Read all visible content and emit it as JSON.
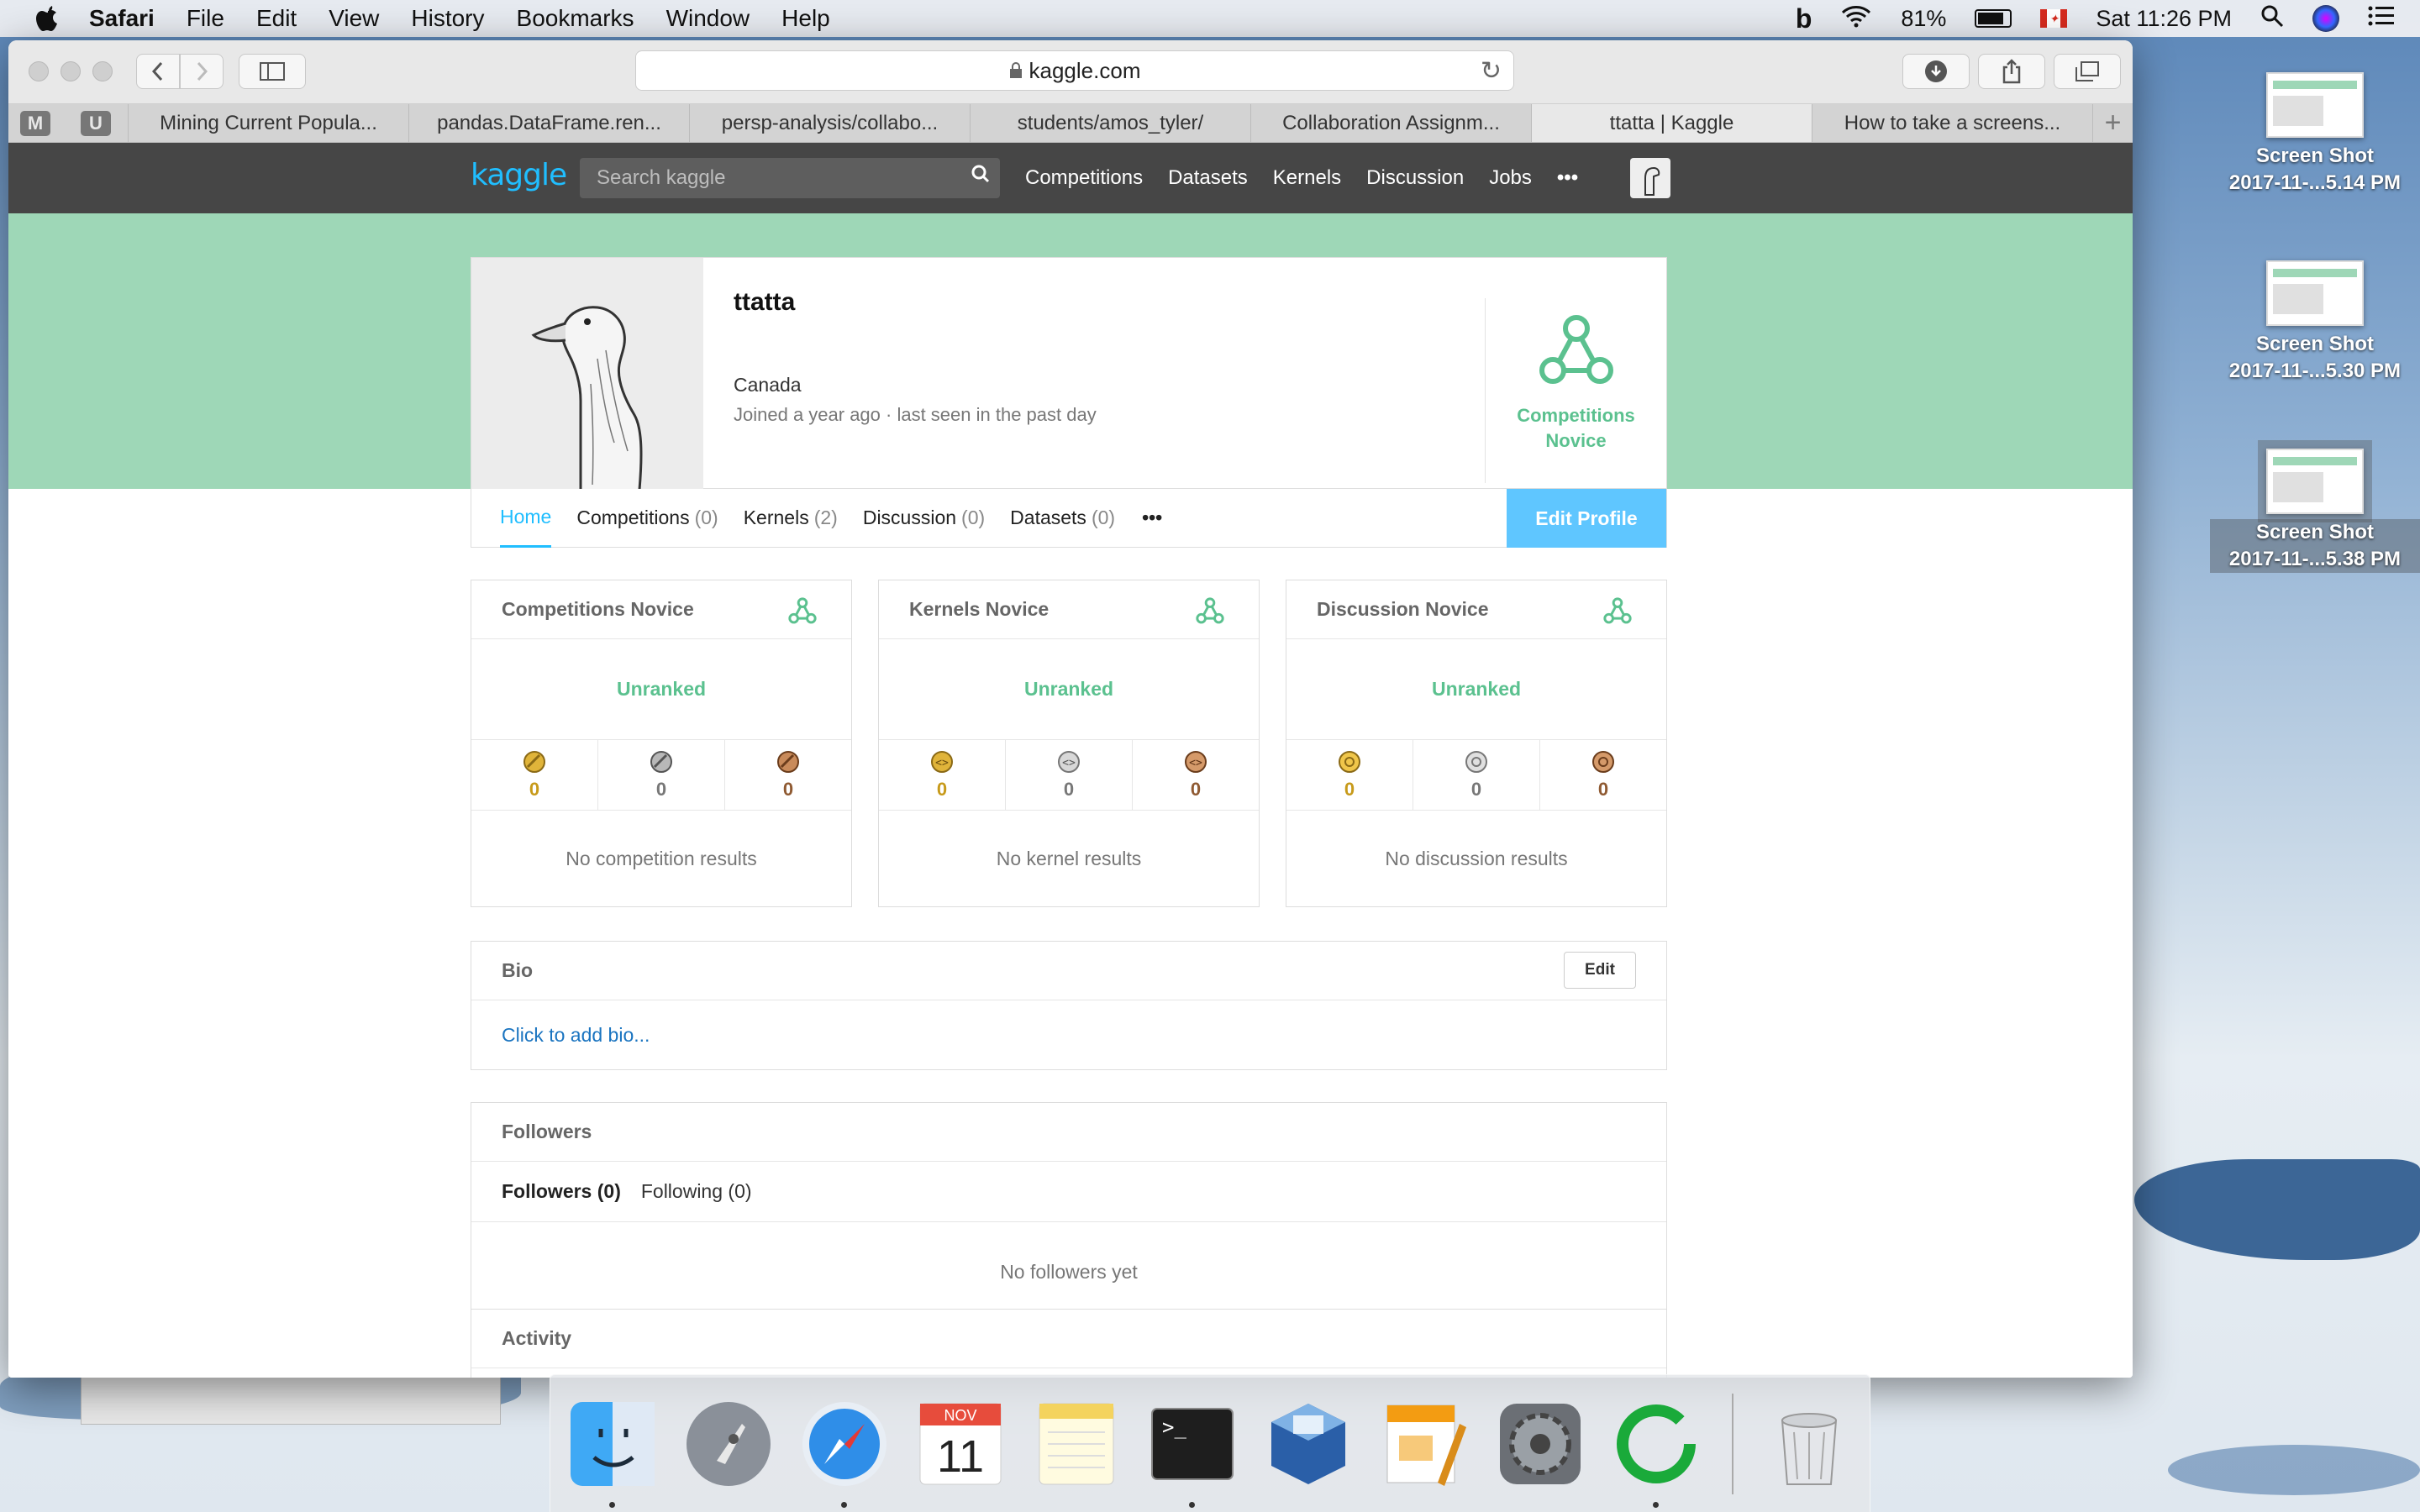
{
  "menubar": {
    "app": "Safari",
    "items": [
      "File",
      "Edit",
      "View",
      "History",
      "Bookmarks",
      "Window",
      "Help"
    ],
    "battery": "81%",
    "clock": "Sat 11:26 PM"
  },
  "browser": {
    "url": "kaggle.com",
    "pinned": [
      "M",
      "U"
    ],
    "tabs": [
      "Mining Current Popula...",
      "pandas.DataFrame.ren...",
      "persp-analysis/collabo...",
      "students/amos_tyler/",
      "Collaboration Assignm...",
      "ttatta | Kaggle",
      "How to take a screens..."
    ],
    "active_tab": 5
  },
  "kaggle": {
    "logo": "kaggle",
    "search_placeholder": "Search kaggle",
    "nav": [
      "Competitions",
      "Datasets",
      "Kernels",
      "Discussion",
      "Jobs",
      "•••"
    ],
    "profile": {
      "username": "ttatta",
      "location": "Canada",
      "joined": "Joined a year ago · last seen in the past day",
      "tier_line1": "Competitions",
      "tier_line2": "Novice"
    },
    "profile_tabs": [
      {
        "label": "Home",
        "count": ""
      },
      {
        "label": "Competitions",
        "count": "(0)"
      },
      {
        "label": "Kernels",
        "count": "(2)"
      },
      {
        "label": "Discussion",
        "count": "(0)"
      },
      {
        "label": "Datasets",
        "count": "(0)"
      }
    ],
    "more": "•••",
    "edit_profile": "Edit Profile",
    "ranks": [
      {
        "title": "Competitions Novice",
        "rank": "Unranked",
        "gold": "0",
        "silver": "0",
        "bronze": "0",
        "empty": "No competition results"
      },
      {
        "title": "Kernels Novice",
        "rank": "Unranked",
        "gold": "0",
        "silver": "0",
        "bronze": "0",
        "empty": "No kernel results"
      },
      {
        "title": "Discussion Novice",
        "rank": "Unranked",
        "gold": "0",
        "silver": "0",
        "bronze": "0",
        "empty": "No discussion results"
      }
    ],
    "bio": {
      "title": "Bio",
      "edit": "Edit",
      "link": "Click to add bio..."
    },
    "followers": {
      "title": "Followers",
      "tab1": "Followers (0)",
      "tab2": "Following (0)",
      "empty": "No followers yet"
    },
    "activity": "Activity"
  },
  "desktop_icons": [
    {
      "line1": "Screen Shot",
      "line2": "2017-11-...5.14 PM"
    },
    {
      "line1": "Screen Shot",
      "line2": "2017-11-...5.30 PM"
    },
    {
      "line1": "Screen Shot",
      "line2": "2017-11-...5.38 PM"
    }
  ],
  "dock": {
    "calendar_month": "NOV",
    "calendar_day": "11",
    "items": [
      "finder-icon",
      "launchpad-icon",
      "safari-icon",
      "calendar-icon",
      "notes-icon",
      "terminal-icon",
      "virtualbox-icon",
      "pages-icon",
      "system-preferences-icon",
      "progress-app-icon",
      "trash-icon"
    ]
  },
  "colors": {
    "kaggle_blue": "#20beff",
    "novice_green": "#5bc18f",
    "band": "#9ed7b7",
    "nav": "#464646"
  }
}
